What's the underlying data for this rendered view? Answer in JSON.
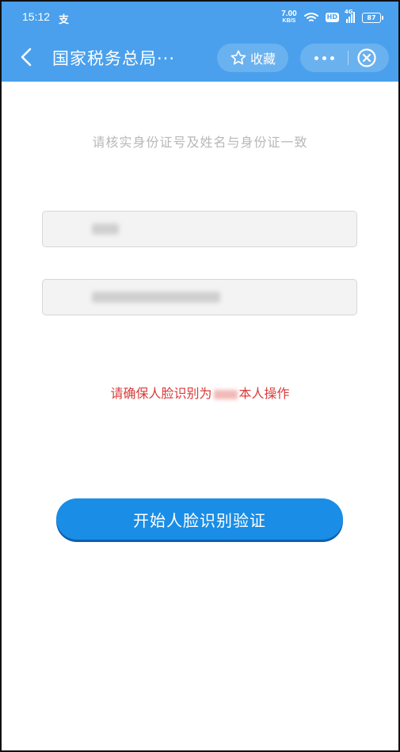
{
  "status_bar": {
    "time": "15:12",
    "alipay_glyph": "支",
    "net_speed_value": "7.00",
    "net_speed_unit": "KB/S",
    "hd_label": "HD",
    "network_label": "4G",
    "battery_level": "87"
  },
  "title_bar": {
    "title": "国家税务总局···",
    "favorite_label": "收藏"
  },
  "content": {
    "hint": "请核实身份证号及姓名与身份证一致",
    "name_field_value_redacted": true,
    "id_field_value_redacted": true,
    "notice_prefix": "请确保人脸识别为",
    "notice_suffix": "本人操作",
    "start_button_label": "开始人脸识别验证"
  },
  "colors": {
    "header_blue": "#4aa0ec",
    "button_blue": "#1a8de6",
    "notice_red": "#d93b3b",
    "hint_gray": "#b8b8b8"
  },
  "icons": {
    "back": "chevron-left-icon",
    "favorite": "star-outline-icon",
    "more": "more-dots-icon",
    "close": "close-circle-icon",
    "wifi": "wifi-icon",
    "signal": "signal-icon",
    "battery": "battery-icon"
  }
}
